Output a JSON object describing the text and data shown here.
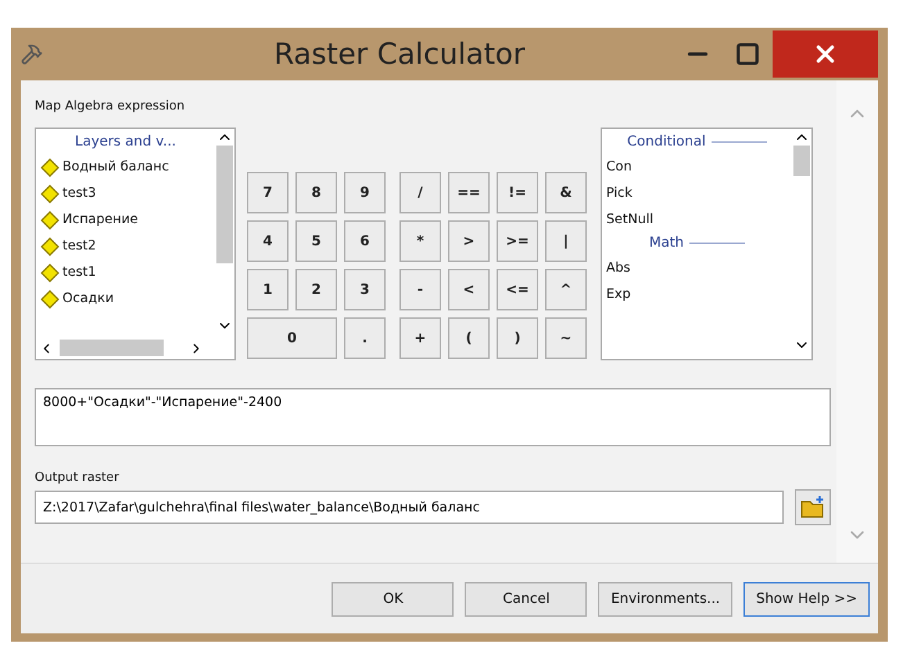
{
  "window": {
    "title": "Raster Calculator"
  },
  "expression_label": "Map Algebra expression",
  "layers": {
    "header": "Layers and v...",
    "items": [
      "Водный баланс",
      "test3",
      "Испарение",
      "test2",
      "test1",
      "Осадки"
    ]
  },
  "keypad": {
    "digits": [
      [
        {
          "label": "7",
          "kind": "normal"
        },
        {
          "label": "8",
          "kind": "normal"
        },
        {
          "label": "9",
          "kind": "normal"
        }
      ],
      [
        {
          "label": "4",
          "kind": "normal"
        },
        {
          "label": "5",
          "kind": "normal"
        },
        {
          "label": "6",
          "kind": "normal"
        }
      ],
      [
        {
          "label": "1",
          "kind": "normal"
        },
        {
          "label": "2",
          "kind": "normal"
        },
        {
          "label": "3",
          "kind": "normal"
        }
      ],
      [
        {
          "label": "0",
          "kind": "wide"
        },
        {
          "label": ".",
          "kind": "normal"
        }
      ]
    ],
    "operators": [
      [
        "/",
        "==",
        "!=",
        "&"
      ],
      [
        "*",
        ">",
        ">=",
        "|"
      ],
      [
        "-",
        "<",
        "<=",
        "^"
      ],
      [
        "+",
        "(",
        ")",
        "~"
      ]
    ]
  },
  "functions": [
    {
      "kind": "header",
      "label": "Conditional"
    },
    {
      "kind": "function",
      "label": "Con"
    },
    {
      "kind": "function",
      "label": "Pick"
    },
    {
      "kind": "function",
      "label": "SetNull"
    },
    {
      "kind": "header",
      "label": "Math"
    },
    {
      "kind": "function",
      "label": "Abs"
    },
    {
      "kind": "function",
      "label": "Exp"
    }
  ],
  "expression": "8000+\"Осадки\"-\"Испарение\"-2400",
  "output": {
    "label": "Output raster",
    "value": "Z:\\2017\\Zafar\\gulchehra\\final files\\water_balance\\Водный баланс"
  },
  "buttons": [
    {
      "label": "OK",
      "default": false
    },
    {
      "label": "Cancel",
      "default": false
    },
    {
      "label": "Environments...",
      "default": false
    },
    {
      "label": "Show Help >>",
      "default": true
    }
  ]
}
